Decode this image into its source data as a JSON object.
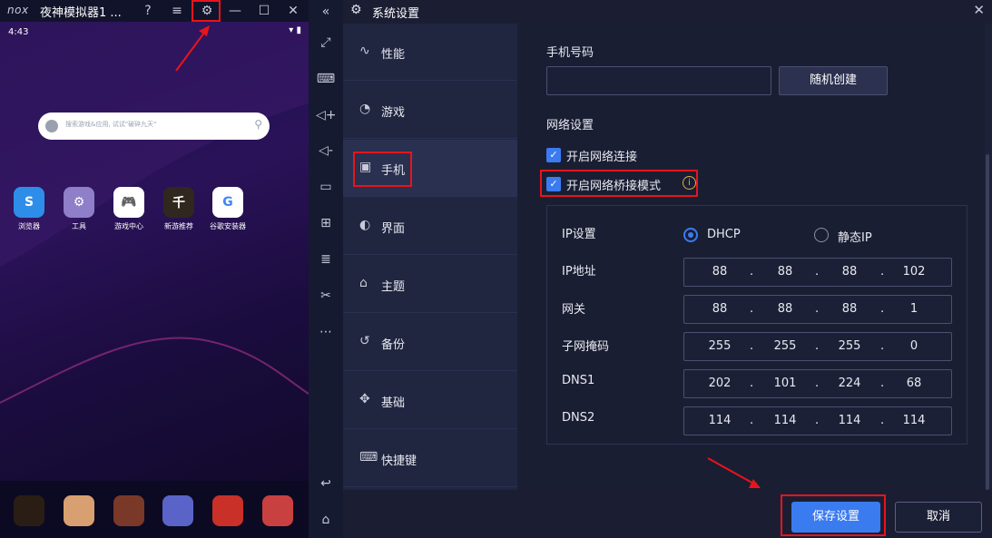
{
  "emulator": {
    "logo": "nox",
    "app_title": "夜神模拟器1 ...",
    "status_time": "4:43",
    "search_placeholder": "搜索游戏&应用, 试试\"破碎九天\"",
    "apps": [
      {
        "label": "浏览器",
        "icon": "browser-icon",
        "color": "#2e8de8"
      },
      {
        "label": "工具",
        "icon": "tools-icon",
        "color": "#8f7ec8"
      },
      {
        "label": "游戏中心",
        "icon": "gamepad-icon",
        "color": "#ffffff"
      },
      {
        "label": "新游推荐",
        "icon": "game-poster-icon",
        "color": "#30281e"
      },
      {
        "label": "谷歌安装器",
        "icon": "google-icon",
        "color": "#ffffff"
      }
    ],
    "dock_colors": [
      "#2a1e14",
      "#d8a070",
      "#7a3828",
      "#5a64c8",
      "#c83028",
      "#c84040"
    ]
  },
  "settings": {
    "title": "系统设置",
    "nav": [
      {
        "label": "性能",
        "icon": "performance-icon",
        "glyph": "∿"
      },
      {
        "label": "游戏",
        "icon": "game-icon",
        "glyph": "◔"
      },
      {
        "label": "手机",
        "icon": "phone-icon",
        "glyph": "▣",
        "active": true
      },
      {
        "label": "界面",
        "icon": "palette-icon",
        "glyph": "◐"
      },
      {
        "label": "主题",
        "icon": "shirt-icon",
        "glyph": "⌂"
      },
      {
        "label": "备份",
        "icon": "backup-icon",
        "glyph": "↺"
      },
      {
        "label": "基础",
        "icon": "puzzle-icon",
        "glyph": "✥"
      },
      {
        "label": "快捷键",
        "icon": "keyboard-icon",
        "glyph": "⌨"
      }
    ],
    "phone_number_label": "手机号码",
    "phone_number_value": "",
    "random_create": "随机创建",
    "network_settings_label": "网络设置",
    "enable_network": "开启网络连接",
    "enable_bridge": "开启网络桥接模式",
    "ip_settings_label": "IP设置",
    "dhcp_label": "DHCP",
    "static_ip_label": "静态IP",
    "ip_mode": "DHCP",
    "rows": [
      {
        "label": "IP地址",
        "octets": [
          "88",
          "88",
          "88",
          "102"
        ]
      },
      {
        "label": "网关",
        "octets": [
          "88",
          "88",
          "88",
          "1"
        ]
      },
      {
        "label": "子网掩码",
        "octets": [
          "255",
          "255",
          "255",
          "0"
        ]
      },
      {
        "label": "DNS1",
        "octets": [
          "202",
          "101",
          "224",
          "68"
        ]
      },
      {
        "label": "DNS2",
        "octets": [
          "114",
          "114",
          "114",
          "114"
        ]
      }
    ],
    "save": "保存设置",
    "cancel": "取消"
  },
  "colors": {
    "accent": "#3a7bf0",
    "highlight": "#e8141b"
  }
}
